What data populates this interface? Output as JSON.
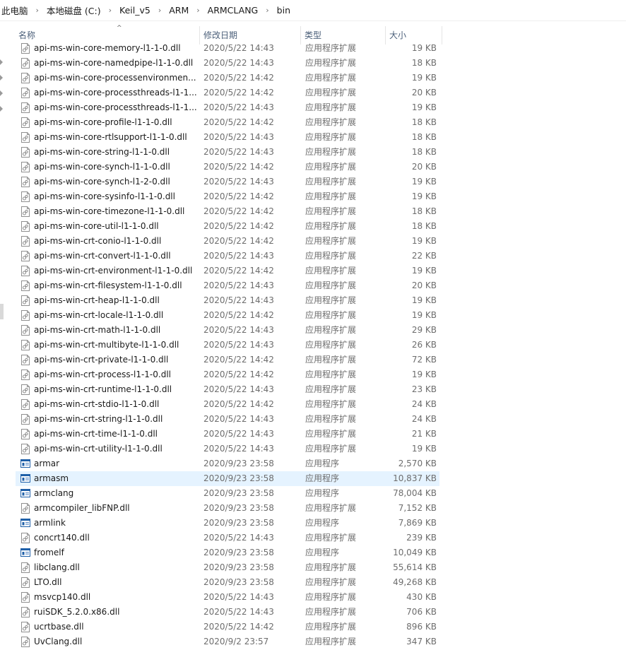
{
  "breadcrumb": [
    "此电脑",
    "本地磁盘 (C:)",
    "Keil_v5",
    "ARM",
    "ARMCLANG",
    "bin"
  ],
  "breadcrumb_separator": "›",
  "columns": {
    "name": "名称",
    "date": "修改日期",
    "type": "类型",
    "size": "大小"
  },
  "sort_indicator": "^",
  "colors": {
    "selected_row": "#e5f3ff",
    "header_text": "#4c607a",
    "exe_icon": "#1e5fa8"
  },
  "files": [
    {
      "name": "api-ms-win-core-memory-l1-1-0.dll",
      "date": "2020/5/22 14:43",
      "type": "应用程序扩展",
      "size": "19 KB",
      "icon": "dll-file-icon"
    },
    {
      "name": "api-ms-win-core-namedpipe-l1-1-0.dll",
      "date": "2020/5/22 14:43",
      "type": "应用程序扩展",
      "size": "18 KB",
      "icon": "dll-file-icon"
    },
    {
      "name": "api-ms-win-core-processenvironmen...",
      "date": "2020/5/22 14:42",
      "type": "应用程序扩展",
      "size": "19 KB",
      "icon": "dll-file-icon"
    },
    {
      "name": "api-ms-win-core-processthreads-l1-1...",
      "date": "2020/5/22 14:42",
      "type": "应用程序扩展",
      "size": "20 KB",
      "icon": "dll-file-icon"
    },
    {
      "name": "api-ms-win-core-processthreads-l1-1...",
      "date": "2020/5/22 14:43",
      "type": "应用程序扩展",
      "size": "19 KB",
      "icon": "dll-file-icon"
    },
    {
      "name": "api-ms-win-core-profile-l1-1-0.dll",
      "date": "2020/5/22 14:42",
      "type": "应用程序扩展",
      "size": "18 KB",
      "icon": "dll-file-icon"
    },
    {
      "name": "api-ms-win-core-rtlsupport-l1-1-0.dll",
      "date": "2020/5/22 14:43",
      "type": "应用程序扩展",
      "size": "18 KB",
      "icon": "dll-file-icon"
    },
    {
      "name": "api-ms-win-core-string-l1-1-0.dll",
      "date": "2020/5/22 14:43",
      "type": "应用程序扩展",
      "size": "18 KB",
      "icon": "dll-file-icon"
    },
    {
      "name": "api-ms-win-core-synch-l1-1-0.dll",
      "date": "2020/5/22 14:42",
      "type": "应用程序扩展",
      "size": "20 KB",
      "icon": "dll-file-icon"
    },
    {
      "name": "api-ms-win-core-synch-l1-2-0.dll",
      "date": "2020/5/22 14:43",
      "type": "应用程序扩展",
      "size": "19 KB",
      "icon": "dll-file-icon"
    },
    {
      "name": "api-ms-win-core-sysinfo-l1-1-0.dll",
      "date": "2020/5/22 14:42",
      "type": "应用程序扩展",
      "size": "19 KB",
      "icon": "dll-file-icon"
    },
    {
      "name": "api-ms-win-core-timezone-l1-1-0.dll",
      "date": "2020/5/22 14:42",
      "type": "应用程序扩展",
      "size": "18 KB",
      "icon": "dll-file-icon"
    },
    {
      "name": "api-ms-win-core-util-l1-1-0.dll",
      "date": "2020/5/22 14:42",
      "type": "应用程序扩展",
      "size": "18 KB",
      "icon": "dll-file-icon"
    },
    {
      "name": "api-ms-win-crt-conio-l1-1-0.dll",
      "date": "2020/5/22 14:42",
      "type": "应用程序扩展",
      "size": "19 KB",
      "icon": "dll-file-icon"
    },
    {
      "name": "api-ms-win-crt-convert-l1-1-0.dll",
      "date": "2020/5/22 14:43",
      "type": "应用程序扩展",
      "size": "22 KB",
      "icon": "dll-file-icon"
    },
    {
      "name": "api-ms-win-crt-environment-l1-1-0.dll",
      "date": "2020/5/22 14:42",
      "type": "应用程序扩展",
      "size": "19 KB",
      "icon": "dll-file-icon"
    },
    {
      "name": "api-ms-win-crt-filesystem-l1-1-0.dll",
      "date": "2020/5/22 14:43",
      "type": "应用程序扩展",
      "size": "20 KB",
      "icon": "dll-file-icon"
    },
    {
      "name": "api-ms-win-crt-heap-l1-1-0.dll",
      "date": "2020/5/22 14:43",
      "type": "应用程序扩展",
      "size": "19 KB",
      "icon": "dll-file-icon"
    },
    {
      "name": "api-ms-win-crt-locale-l1-1-0.dll",
      "date": "2020/5/22 14:42",
      "type": "应用程序扩展",
      "size": "19 KB",
      "icon": "dll-file-icon"
    },
    {
      "name": "api-ms-win-crt-math-l1-1-0.dll",
      "date": "2020/5/22 14:43",
      "type": "应用程序扩展",
      "size": "29 KB",
      "icon": "dll-file-icon"
    },
    {
      "name": "api-ms-win-crt-multibyte-l1-1-0.dll",
      "date": "2020/5/22 14:43",
      "type": "应用程序扩展",
      "size": "26 KB",
      "icon": "dll-file-icon"
    },
    {
      "name": "api-ms-win-crt-private-l1-1-0.dll",
      "date": "2020/5/22 14:42",
      "type": "应用程序扩展",
      "size": "72 KB",
      "icon": "dll-file-icon"
    },
    {
      "name": "api-ms-win-crt-process-l1-1-0.dll",
      "date": "2020/5/22 14:42",
      "type": "应用程序扩展",
      "size": "19 KB",
      "icon": "dll-file-icon"
    },
    {
      "name": "api-ms-win-crt-runtime-l1-1-0.dll",
      "date": "2020/5/22 14:43",
      "type": "应用程序扩展",
      "size": "23 KB",
      "icon": "dll-file-icon"
    },
    {
      "name": "api-ms-win-crt-stdio-l1-1-0.dll",
      "date": "2020/5/22 14:42",
      "type": "应用程序扩展",
      "size": "24 KB",
      "icon": "dll-file-icon"
    },
    {
      "name": "api-ms-win-crt-string-l1-1-0.dll",
      "date": "2020/5/22 14:43",
      "type": "应用程序扩展",
      "size": "24 KB",
      "icon": "dll-file-icon"
    },
    {
      "name": "api-ms-win-crt-time-l1-1-0.dll",
      "date": "2020/5/22 14:43",
      "type": "应用程序扩展",
      "size": "21 KB",
      "icon": "dll-file-icon"
    },
    {
      "name": "api-ms-win-crt-utility-l1-1-0.dll",
      "date": "2020/5/22 14:43",
      "type": "应用程序扩展",
      "size": "19 KB",
      "icon": "dll-file-icon"
    },
    {
      "name": "armar",
      "date": "2020/9/23 23:58",
      "type": "应用程序",
      "size": "2,570 KB",
      "icon": "exe-file-icon"
    },
    {
      "name": "armasm",
      "date": "2020/9/23 23:58",
      "type": "应用程序",
      "size": "10,837 KB",
      "icon": "exe-file-icon",
      "selected": true
    },
    {
      "name": "armclang",
      "date": "2020/9/23 23:58",
      "type": "应用程序",
      "size": "78,004 KB",
      "icon": "exe-file-icon"
    },
    {
      "name": "armcompiler_libFNP.dll",
      "date": "2020/9/23 23:58",
      "type": "应用程序扩展",
      "size": "7,152 KB",
      "icon": "dll-file-icon"
    },
    {
      "name": "armlink",
      "date": "2020/9/23 23:58",
      "type": "应用程序",
      "size": "7,869 KB",
      "icon": "exe-file-icon"
    },
    {
      "name": "concrt140.dll",
      "date": "2020/5/22 14:43",
      "type": "应用程序扩展",
      "size": "239 KB",
      "icon": "dll-file-icon"
    },
    {
      "name": "fromelf",
      "date": "2020/9/23 23:58",
      "type": "应用程序",
      "size": "10,049 KB",
      "icon": "exe-file-icon"
    },
    {
      "name": "libclang.dll",
      "date": "2020/9/23 23:58",
      "type": "应用程序扩展",
      "size": "55,614 KB",
      "icon": "dll-file-icon"
    },
    {
      "name": "LTO.dll",
      "date": "2020/9/23 23:58",
      "type": "应用程序扩展",
      "size": "49,268 KB",
      "icon": "dll-file-icon"
    },
    {
      "name": "msvcp140.dll",
      "date": "2020/5/22 14:43",
      "type": "应用程序扩展",
      "size": "430 KB",
      "icon": "dll-file-icon"
    },
    {
      "name": "ruiSDK_5.2.0.x86.dll",
      "date": "2020/5/22 14:43",
      "type": "应用程序扩展",
      "size": "706 KB",
      "icon": "dll-file-icon"
    },
    {
      "name": "ucrtbase.dll",
      "date": "2020/5/22 14:42",
      "type": "应用程序扩展",
      "size": "896 KB",
      "icon": "dll-file-icon"
    },
    {
      "name": "UvClang.dll",
      "date": "2020/9/2 23:57",
      "type": "应用程序扩展",
      "size": "347 KB",
      "icon": "dll-file-icon"
    }
  ]
}
